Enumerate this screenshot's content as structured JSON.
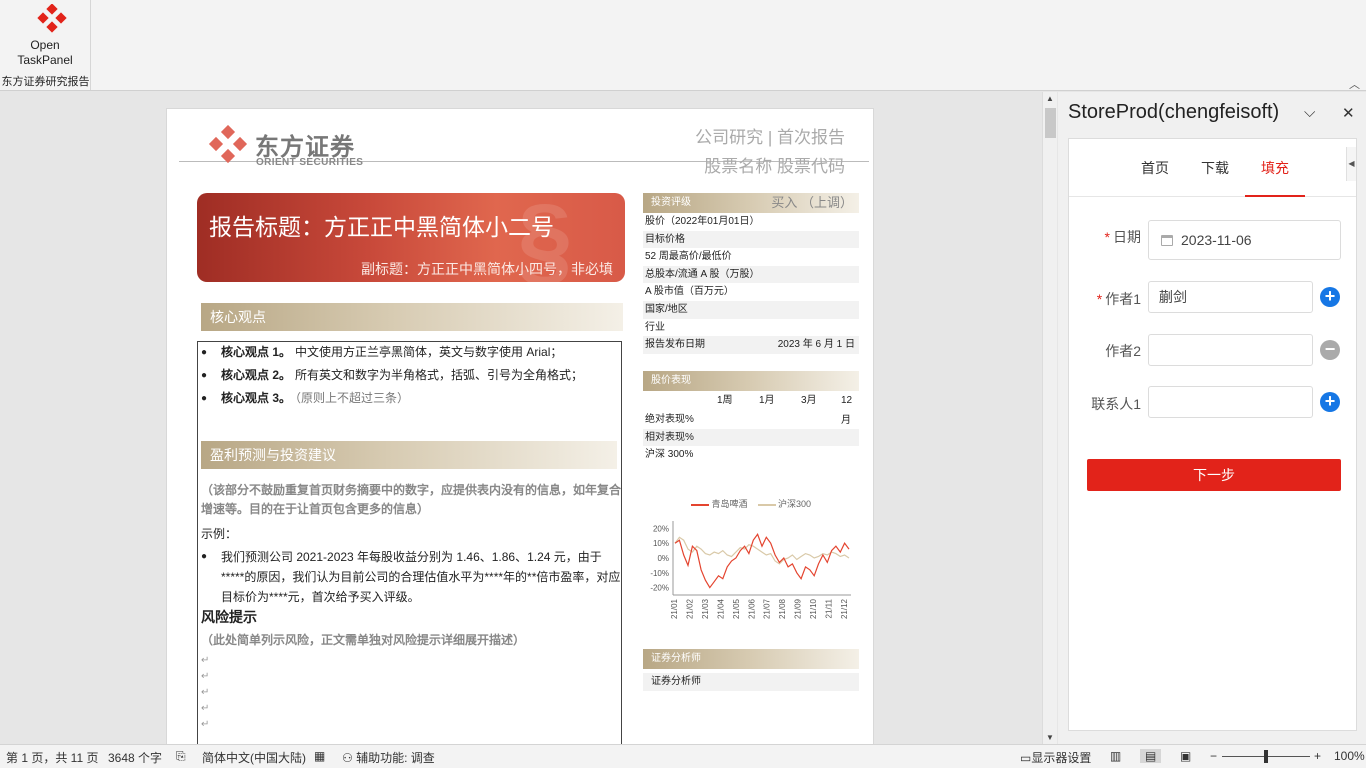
{
  "ribbon": {
    "open_taskpanel": "Open\nTaskPanel",
    "group_label": "东方证券研究报告"
  },
  "doc": {
    "brand_cn": "东方证券",
    "brand_en": "ORIENT SECURITIES",
    "header_line1": "公司研究 | 首次报告",
    "header_line2": "股票名称 股票代码",
    "banner_title": "报告标题：方正正中黑简体小二号",
    "banner_subtitle": "副标题：方正正中黑简体小四号，非必填",
    "sec_core": "核心观点",
    "core_points": [
      {
        "head": "核心观点 1。",
        "text": "中文使用方正兰亭黑简体，英文与数字使用 Arial；"
      },
      {
        "head": "核心观点 2。",
        "text": "所有英文和数字为半角格式，括弧、引号为全角格式；"
      },
      {
        "head": "核心观点 3。",
        "text": "（原则上不超过三条）"
      }
    ],
    "sec_forecast": "盈利预测与投资建议",
    "forecast_note": "（该部分不鼓励重复首页财务摘要中的数字，应提供表内没有的信息，如年复合增速等。目的在于让首页包含更多的信息）",
    "example_label": "示例：",
    "prediction": "我们预测公司 2021-2023 年每股收益分别为 1.46、1.86、1.24 元，由于*****的原因，我们认为目前公司的合理估值水平为****年的**倍市盈率，对应目标价为****元，首次给予买入评级。",
    "risk_title": "风险提示",
    "risk_note": "（此处简单列示风险，正文需单独对风险提示详细展开描述）",
    "rating_bar": "投资评级",
    "rating_value": "买入 （上调）",
    "rating_rows": [
      {
        "k": "股价（2022年01月01日）",
        "v": ""
      },
      {
        "k": "目标价格",
        "v": ""
      },
      {
        "k": "52 周最高价/最低价",
        "v": ""
      },
      {
        "k": "总股本/流通 A 股（万股）",
        "v": ""
      },
      {
        "k": "A 股市值（百万元）",
        "v": ""
      },
      {
        "k": "国家/地区",
        "v": ""
      },
      {
        "k": "行业",
        "v": ""
      },
      {
        "k": "报告发布日期",
        "v": "2023 年 6 月 1 日"
      }
    ],
    "perf_bar": "股价表现",
    "perf_cols": [
      "1周",
      "1月",
      "3月",
      "12月"
    ],
    "perf_rows": [
      "绝对表现%",
      "相对表现%",
      "沪深 300%"
    ],
    "analyst_bar": "证券分析师",
    "analyst_label": "证券分析师"
  },
  "chart_data": {
    "type": "line",
    "legend": [
      "青岛啤酒",
      "沪深300"
    ],
    "y_ticks": [
      "20%",
      "10%",
      "0%",
      "-10%",
      "-20%"
    ],
    "ylim": [
      -25,
      25
    ],
    "x_ticks": [
      "21/01",
      "21/02",
      "21/03",
      "21/04",
      "21/05",
      "21/06",
      "21/07",
      "21/08",
      "21/09",
      "21/10",
      "21/11",
      "21/12"
    ],
    "series": [
      {
        "name": "青岛啤酒",
        "color": "#e4442f",
        "values": [
          10,
          12,
          2,
          -5,
          8,
          5,
          -8,
          -15,
          -20,
          -16,
          -12,
          -14,
          -6,
          -2,
          0,
          5,
          8,
          3,
          12,
          16,
          8,
          14,
          10,
          2,
          -3,
          0,
          -6,
          -4,
          -10,
          -14,
          -6,
          -8,
          -12,
          -4,
          2,
          -3,
          5,
          8,
          4,
          10,
          6
        ]
      },
      {
        "name": "沪深300",
        "color": "#d9c9a8",
        "values": [
          10,
          14,
          12,
          6,
          4,
          8,
          6,
          3,
          2,
          4,
          3,
          5,
          2,
          1,
          4,
          7,
          6,
          9,
          8,
          6,
          4,
          2,
          3,
          -2,
          -4,
          -1,
          0,
          2,
          -1,
          1,
          3,
          2,
          0,
          1,
          3,
          2,
          4,
          3,
          1,
          2,
          0
        ]
      }
    ]
  },
  "status": {
    "page": "第 1 页，共 11 页",
    "words": "3648 个字",
    "lang": "简体中文(中国大陆)",
    "accessibility": "辅助功能: 调查",
    "display": "显示器设置",
    "zoom": "100%"
  },
  "pane": {
    "title": "StoreProd(chengfeisoft)",
    "tabs": [
      "首页",
      "下载",
      "填充"
    ],
    "active_tab": 2,
    "date_label": "日期",
    "date_value": "2023-11-06",
    "author1_label": "作者1",
    "author1_value": "蒯剑",
    "author2_label": "作者2",
    "author2_value": "",
    "contact1_label": "联系人1",
    "contact1_value": "",
    "next_button": "下一步",
    "accent_color": "#e2231a",
    "add_color": "#1677e5"
  }
}
